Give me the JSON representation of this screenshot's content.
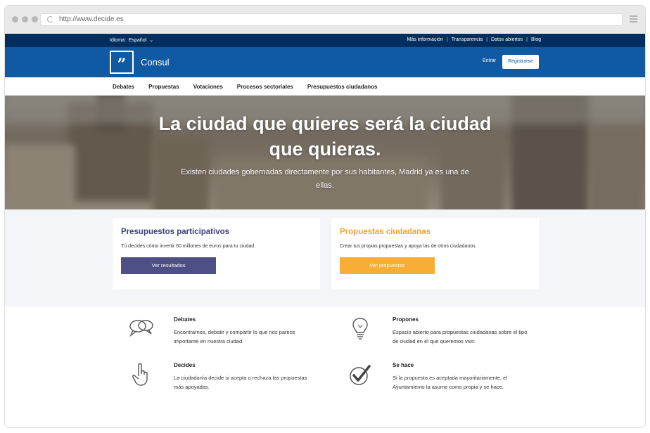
{
  "browser": {
    "url": "http://www.decide.es"
  },
  "topbar": {
    "language_label": "Idioma:",
    "language_value": "Español",
    "links": [
      "Más información",
      "Transparencia",
      "Datos abiertos",
      "Blog"
    ]
  },
  "header": {
    "logo_glyph": "”",
    "site_name": "Consul",
    "login_label": "Entrar",
    "register_label": "Registrarse"
  },
  "nav": {
    "items": [
      "Debates",
      "Propuestas",
      "Votaciones",
      "Procesos sectoriales",
      "Presupuestos ciudadanos"
    ]
  },
  "hero": {
    "title": "La ciudad que quieres será la ciudad que quieras.",
    "subtitle": "Existen ciudades gobernadas directamente por sus habitantes, Madrid ya es una de ellas."
  },
  "cards": [
    {
      "title": "Presupuestos participativos",
      "text": "Tú decides cómo invertir 60 millones de euros para tu ciudad.",
      "button": "Ver resultados",
      "color": "#4e4f84"
    },
    {
      "title": "Propuestas ciudadanas",
      "text": "Crear tus propias propuestas y apoya las de otros ciudadanos.",
      "button": "Ver propuestas",
      "color": "#f8ad35"
    }
  ],
  "features": [
    {
      "title": "Debates",
      "text": "Encontrarnos, debatir y compartir lo que nos parece importante en nuestra ciudad.",
      "icon": "speech-bubbles-icon"
    },
    {
      "title": "Propones",
      "text": "Espacio abierto para propuestas ciudadanas sobre el tipo de ciudad en el que queremos vivir.",
      "icon": "lightbulb-icon"
    },
    {
      "title": "Decides",
      "text": "La ciudadanía decide si acepta o rechaza las propuestas más apoyadas.",
      "icon": "pointing-hand-icon"
    },
    {
      "title": "Se hace",
      "text": "Si la propuesta es aceptada mayoritariamente, el Ayuntamiento la asume como propia y se hace.",
      "icon": "checkmark-circle-icon"
    }
  ],
  "colors": {
    "topbar": "#002f5f",
    "header": "#0f5aa2",
    "purple": "#4e4f84",
    "orange": "#f8ad35"
  }
}
